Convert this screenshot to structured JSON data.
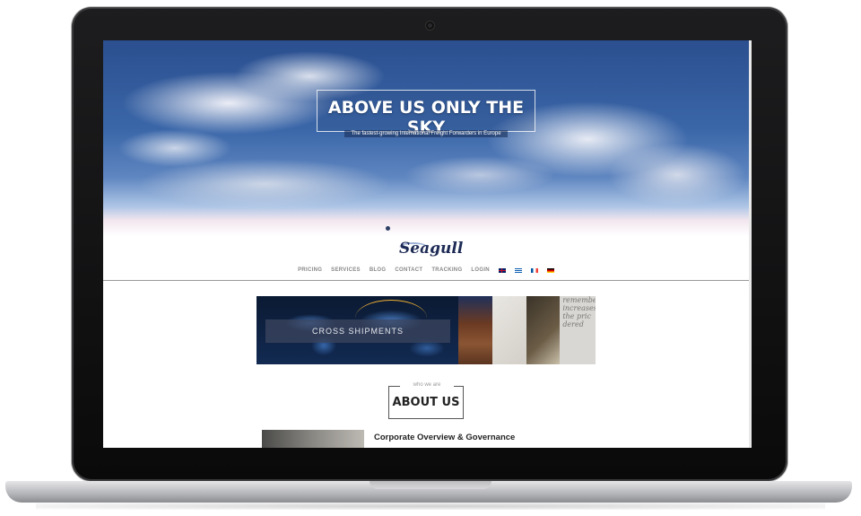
{
  "hero": {
    "title": "ABOVE US ONLY THE SKY",
    "subtitle": "The fastest-growing International Freight Forwarders in Europe",
    "slides_total": 1,
    "active_slide": 1
  },
  "logo": {
    "text": "Seagull"
  },
  "nav": {
    "items": [
      "PRICING",
      "SERVICES",
      "BLOG",
      "CONTACT",
      "TRACKING",
      "LOGIN"
    ],
    "flags": [
      "uk-flag-icon",
      "greece-flag-icon",
      "france-flag-icon",
      "germany-flag-icon"
    ]
  },
  "banner": {
    "label": "CROSS SHIPMENTS",
    "tile_text": "remember\nincreases\nthe pric\ndered"
  },
  "about": {
    "kicker": "who we are",
    "title": "ABOUT US"
  },
  "corporate": {
    "heading": "Corporate Overview & Governance"
  }
}
